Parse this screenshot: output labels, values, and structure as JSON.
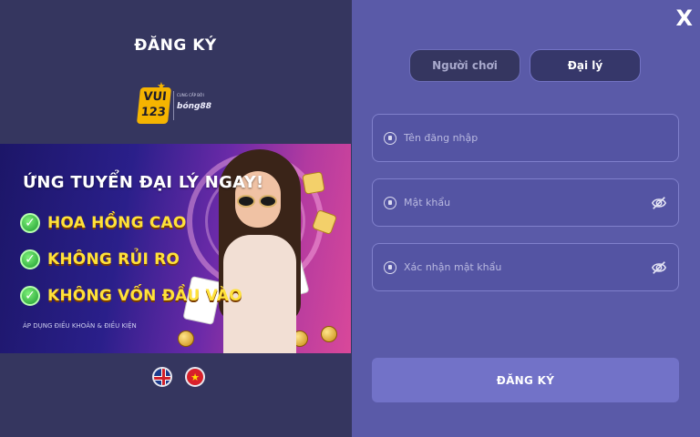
{
  "left": {
    "title": "ĐĂNG KÝ",
    "logo": {
      "brand": "VUI123",
      "brand_top": "VUI",
      "brand_bottom": "123",
      "tagline_small": "CUNG CẤP BỞI",
      "partner": "bóng88"
    },
    "banner": {
      "headline": "ỨNG TUYỂN ĐẠI LÝ NGAY!",
      "perks": [
        "HOA HỒNG CAO",
        "KHÔNG RỦI RO",
        "KHÔNG VỐN ĐẦU VÀO"
      ],
      "terms": "ÁP DỤNG ĐIỀU KHOẢN & ĐIỀU KIỆN"
    },
    "languages": [
      {
        "name": "english",
        "icon": "uk-flag-icon"
      },
      {
        "name": "vietnamese",
        "icon": "vn-flag-icon"
      }
    ]
  },
  "right": {
    "close_label": "X",
    "tabs": [
      {
        "label": "Người chơi",
        "active": false
      },
      {
        "label": "Đại lý",
        "active": true
      }
    ],
    "fields": {
      "username": {
        "placeholder": "Tên đăng nhập",
        "icon": "user-icon"
      },
      "password": {
        "placeholder": "Mật khẩu",
        "icon": "lock-icon"
      },
      "confirm_password": {
        "placeholder": "Xác nhận mật khẩu",
        "icon": "lock-icon"
      }
    },
    "submit_label": "ĐĂNG KÝ"
  },
  "colors": {
    "left_bg": "#35365f",
    "right_bg": "#5a5aa8",
    "button_bg": "#7272c8",
    "perk_text": "#ffe23a"
  }
}
